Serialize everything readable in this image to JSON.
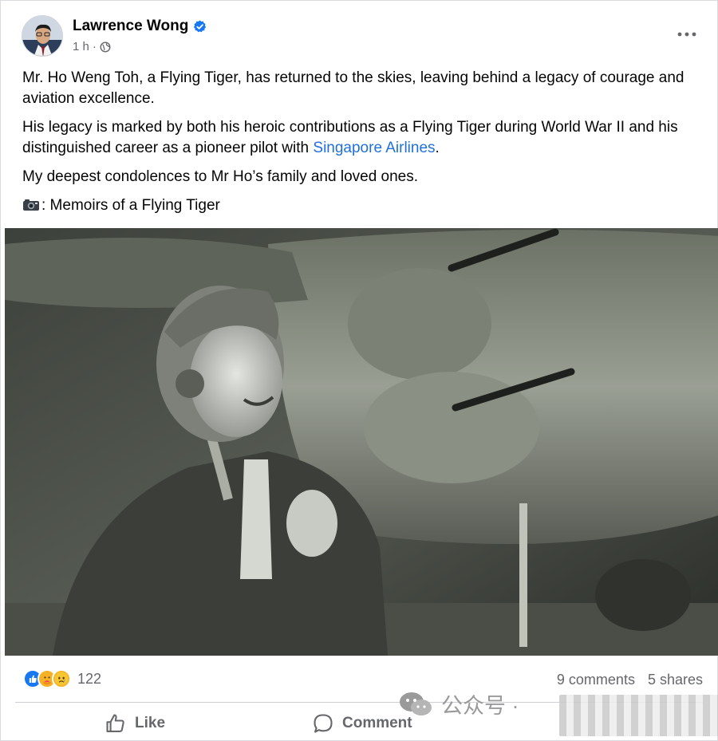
{
  "post": {
    "author": "Lawrence Wong",
    "time": "1 h",
    "meta_separator": "·",
    "paragraphs": {
      "p1": "Mr. Ho Weng Toh, a Flying Tiger, has returned to the skies, leaving behind a legacy of courage and aviation excellence.",
      "p2_before": "His legacy is marked by both his heroic contributions as a Flying Tiger during World War II and his distinguished career as a pioneer pilot with ",
      "p2_link": "Singapore Airlines",
      "p2_after": ".",
      "p3": "My deepest condolences to Mr Ho’s family and loved ones.",
      "p4": ": Memoirs of a Flying Tiger"
    }
  },
  "stats": {
    "reaction_count": "122",
    "comments": "9 comments",
    "shares": "5 shares"
  },
  "actions": {
    "like": "Like",
    "comment": "Comment"
  },
  "watermark": {
    "text": "公众号 ·"
  },
  "icons": {
    "verified": "verified-badge-icon",
    "globe": "globe-icon",
    "more": "more-options-icon",
    "camera": "camera-icon",
    "like": "thumbs-up-icon",
    "comment": "comment-bubble-icon"
  },
  "colors": {
    "text": "#050505",
    "secondary": "#65676b",
    "link": "#216fdb",
    "verified": "#1877f2"
  }
}
